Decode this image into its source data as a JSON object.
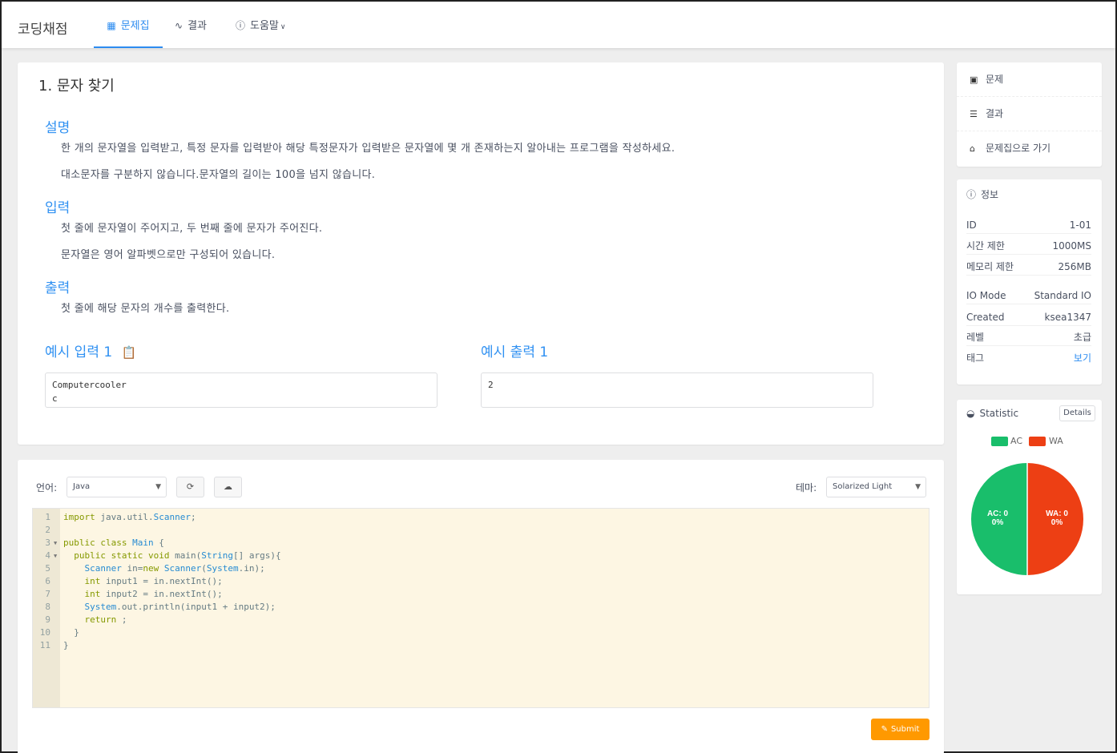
{
  "header": {
    "brand": "코딩채점",
    "nav": [
      {
        "label": "문제집",
        "icon": "grid-icon"
      },
      {
        "label": "결과",
        "icon": "pulse-icon"
      },
      {
        "label": "도움말",
        "icon": "info-icon"
      }
    ]
  },
  "problem": {
    "title": "1. 문자 찾기",
    "description_title": "설명",
    "description": [
      "한 개의 문자열을 입력받고, 특정 문자를 입력받아 해당 특정문자가 입력받은 문자열에 몇 개 존재하는지 알아내는 프로그램을 작성하세요.",
      "대소문자를 구분하지 않습니다.문자열의 길이는 100을 넘지 않습니다."
    ],
    "input_title": "입력",
    "input": [
      "첫 줄에 문자열이 주어지고, 두 번째 줄에 문자가 주어진다.",
      "문자열은 영어 알파벳으로만 구성되어 있습니다."
    ],
    "output_title": "출력",
    "output": [
      "첫 줄에 해당 문자의 개수를 출력한다."
    ],
    "sample_input_title": "예시 입력 1",
    "sample_output_title": "예시 출력 1",
    "sample_input": "Computercooler\nc",
    "sample_output": "2"
  },
  "editor": {
    "language_label": "언어:",
    "language": "Java",
    "theme_label": "테마:",
    "theme": "Solarized Light",
    "submit_label": "Submit",
    "code_lines": [
      "import java.util.Scanner;",
      "",
      "public class Main {",
      "  public static void main(String[] args){",
      "    Scanner in=new Scanner(System.in);",
      "    int input1 = in.nextInt();",
      "    int input2 = in.nextInt();",
      "    System.out.println(input1 + input2);",
      "    return ;",
      "  }",
      "}"
    ]
  },
  "sidebar": {
    "menu": [
      {
        "label": "문제",
        "icon": "book-icon"
      },
      {
        "label": "결과",
        "icon": "list-icon"
      },
      {
        "label": "문제집으로 가기",
        "icon": "home-icon"
      }
    ],
    "info_title": "정보",
    "info": [
      {
        "key": "ID",
        "value": "1-01"
      },
      {
        "key": "시간 제한",
        "value": "1000MS"
      },
      {
        "key": "메모리 제한",
        "value": "256MB"
      },
      {
        "key": "IO Mode",
        "value": "Standard IO"
      },
      {
        "key": "Created",
        "value": "ksea1347"
      },
      {
        "key": "레벨",
        "value": "초급"
      },
      {
        "key": "태그",
        "value": "보기"
      }
    ],
    "statistic_title": "Statistic",
    "details_label": "Details",
    "legend": [
      {
        "name": "AC",
        "color": "#19be6b"
      },
      {
        "name": "WA",
        "color": "#ed3f14"
      }
    ],
    "pie": [
      {
        "label": "AC: 0",
        "pct": "0%",
        "color": "#19be6b"
      },
      {
        "label": "WA: 0",
        "pct": "0%",
        "color": "#ed3f14"
      }
    ]
  }
}
